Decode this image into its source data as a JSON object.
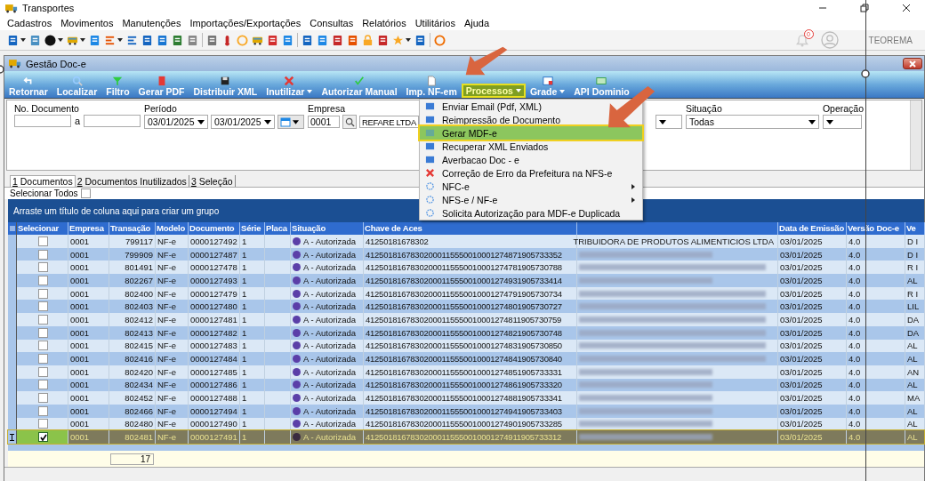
{
  "window": {
    "title": "Transportes"
  },
  "menu": [
    "Cadastros",
    "Movimentos",
    "Manutenções",
    "Importações/Exportações",
    "Consultas",
    "Relatórios",
    "Utilitários",
    "Ajuda"
  ],
  "notifications": {
    "count": "0"
  },
  "user": {
    "name": "TEOREMA"
  },
  "doc_window": {
    "title": "Gestão Doc-e",
    "ribbon": [
      {
        "label": "Retornar",
        "dropdown": false,
        "selected": false
      },
      {
        "label": "Localizar",
        "dropdown": false,
        "selected": false
      },
      {
        "label": "Filtro",
        "dropdown": false,
        "selected": false
      },
      {
        "label": "Gerar PDF",
        "dropdown": false,
        "selected": false
      },
      {
        "label": "Distribuir XML",
        "dropdown": false,
        "selected": false
      },
      {
        "label": "Inutilizar",
        "dropdown": true,
        "selected": false
      },
      {
        "label": "Autorizar Manual",
        "dropdown": false,
        "selected": false
      },
      {
        "label": "Imp. NF-em",
        "dropdown": false,
        "selected": false
      },
      {
        "label": "Processos",
        "dropdown": true,
        "selected": true
      },
      {
        "label": "Grade",
        "dropdown": true,
        "selected": false
      },
      {
        "label": "API Dominio",
        "dropdown": false,
        "selected": false
      }
    ],
    "filters": {
      "no_documento": {
        "label": "No. Documento",
        "separator": "a"
      },
      "periodo": {
        "label": "Período",
        "from": "03/01/2025",
        "to": "03/01/2025"
      },
      "empresa": {
        "label": "Empresa",
        "code": "0001",
        "name": "REFARE LTDA"
      },
      "situacao": {
        "label": "Situação",
        "value": "Todas"
      },
      "operacao": {
        "label": "Operação"
      }
    },
    "process_menu": [
      {
        "label": "Enviar Email (Pdf, XML)",
        "selected": false
      },
      {
        "label": "Reimpressão de Documento",
        "selected": false
      },
      {
        "label": "Gerar MDF-e",
        "selected": true
      },
      {
        "label": "Recuperar XML Enviados",
        "selected": false
      },
      {
        "label": "Averbacao Doc - e",
        "selected": false
      },
      {
        "label": "Correção de Erro da Prefeitura na NFS-e",
        "selected": false
      },
      {
        "label": "NFC-e",
        "selected": false,
        "submenu": true
      },
      {
        "label": "NFS-e / NF-e",
        "selected": false,
        "submenu": true
      },
      {
        "label": "Solicita Autorização para MDF-e Duplicada",
        "selected": false
      }
    ],
    "tabs": [
      {
        "number": "1",
        "label": " Documentos",
        "selected": true
      },
      {
        "number": "2",
        "label": " Documentos Inutilizados",
        "selected": false
      },
      {
        "number": "3",
        "label": " Seleção",
        "selected": false
      }
    ],
    "select_all": {
      "label": "Selecionar Todos",
      "checked": false
    },
    "group_hint": "Arraste um título de coluna aqui para criar um grupo",
    "columns": [
      "Selecionar",
      "Empresa",
      "Transação",
      "Modelo",
      "Documento",
      "Série",
      "Placa",
      "Situação",
      "Chave de Aces",
      null,
      "Data de Emissão",
      "Versão Doc-e",
      "Ve"
    ],
    "rows": [
      {
        "checked": false,
        "selected": false,
        "empresa": "0001",
        "transacao": "799117",
        "modelo": "NF-e",
        "documento": "0000127492",
        "serie": "1",
        "situacao": "A - Autorizada",
        "chave": "41250181678302",
        "name": "TRIBUIDORA DE PRODUTOS ALIMENTICIOS LTDA",
        "data": "03/01/2025",
        "versao": "4.0",
        "column_13": "D I"
      },
      {
        "checked": false,
        "selected": false,
        "empresa": "0001",
        "transacao": "799909",
        "modelo": "NF-e",
        "documento": "0000127487",
        "serie": "1",
        "situacao": "A - Autorizada",
        "chave": "41250181678302000115550010001274871905733352",
        "data": "03/01/2025",
        "versao": "4.0",
        "column_13": "D I"
      },
      {
        "checked": false,
        "selected": false,
        "empresa": "0001",
        "transacao": "801491",
        "modelo": "NF-e",
        "documento": "0000127478",
        "serie": "1",
        "situacao": "A - Autorizada",
        "chave": "41250181678302000115550010001274781905730788",
        "data": "03/01/2025",
        "versao": "4.0",
        "column_13": "R I"
      },
      {
        "checked": false,
        "selected": false,
        "empresa": "0001",
        "transacao": "802267",
        "modelo": "NF-e",
        "documento": "0000127493",
        "serie": "1",
        "situacao": "A - Autorizada",
        "chave": "41250181678302000115550010001274931905733414",
        "data": "03/01/2025",
        "versao": "4.0",
        "column_13": "AL"
      },
      {
        "checked": false,
        "selected": false,
        "empresa": "0001",
        "transacao": "802400",
        "modelo": "NF-e",
        "documento": "0000127479",
        "serie": "1",
        "situacao": "A - Autorizada",
        "chave": "41250181678302000115550010001274791905730734",
        "data": "03/01/2025",
        "versao": "4.0",
        "column_13": "R I"
      },
      {
        "checked": false,
        "selected": false,
        "empresa": "0001",
        "transacao": "802403",
        "modelo": "NF-e",
        "documento": "0000127480",
        "serie": "1",
        "situacao": "A - Autorizada",
        "chave": "41250181678302000115550010001274801905730727",
        "data": "03/01/2025",
        "versao": "4.0",
        "column_13": "LIL"
      },
      {
        "checked": false,
        "selected": false,
        "empresa": "0001",
        "transacao": "802412",
        "modelo": "NF-e",
        "documento": "0000127481",
        "serie": "1",
        "situacao": "A - Autorizada",
        "chave": "41250181678302000115550010001274811905730759",
        "data": "03/01/2025",
        "versao": "4.0",
        "column_13": "DA"
      },
      {
        "checked": false,
        "selected": false,
        "empresa": "0001",
        "transacao": "802413",
        "modelo": "NF-e",
        "documento": "0000127482",
        "serie": "1",
        "situacao": "A - Autorizada",
        "chave": "41250181678302000115550010001274821905730748",
        "data": "03/01/2025",
        "versao": "4.0",
        "column_13": "DA"
      },
      {
        "checked": false,
        "selected": false,
        "empresa": "0001",
        "transacao": "802415",
        "modelo": "NF-e",
        "documento": "0000127483",
        "serie": "1",
        "situacao": "A - Autorizada",
        "chave": "41250181678302000115550010001274831905730850",
        "data": "03/01/2025",
        "versao": "4.0",
        "column_13": "AL"
      },
      {
        "checked": false,
        "selected": false,
        "empresa": "0001",
        "transacao": "802416",
        "modelo": "NF-e",
        "documento": "0000127484",
        "serie": "1",
        "situacao": "A - Autorizada",
        "chave": "41250181678302000115550010001274841905730840",
        "data": "03/01/2025",
        "versao": "4.0",
        "column_13": "AL"
      },
      {
        "checked": false,
        "selected": false,
        "empresa": "0001",
        "transacao": "802420",
        "modelo": "NF-e",
        "documento": "0000127485",
        "serie": "1",
        "situacao": "A - Autorizada",
        "chave": "41250181678302000115550010001274851905733331",
        "data": "03/01/2025",
        "versao": "4.0",
        "column_13": "AN"
      },
      {
        "checked": false,
        "selected": false,
        "empresa": "0001",
        "transacao": "802434",
        "modelo": "NF-e",
        "documento": "0000127486",
        "serie": "1",
        "situacao": "A - Autorizada",
        "chave": "41250181678302000115550010001274861905733320",
        "data": "03/01/2025",
        "versao": "4.0",
        "column_13": "AL"
      },
      {
        "checked": false,
        "selected": false,
        "empresa": "0001",
        "transacao": "802452",
        "modelo": "NF-e",
        "documento": "0000127488",
        "serie": "1",
        "situacao": "A - Autorizada",
        "chave": "41250181678302000115550010001274881905733341",
        "data": "03/01/2025",
        "versao": "4.0",
        "column_13": "MA"
      },
      {
        "checked": false,
        "selected": false,
        "empresa": "0001",
        "transacao": "802466",
        "modelo": "NF-e",
        "documento": "0000127494",
        "serie": "1",
        "situacao": "A - Autorizada",
        "chave": "41250181678302000115550010001274941905733403",
        "data": "03/01/2025",
        "versao": "4.0",
        "column_13": "AL"
      },
      {
        "checked": false,
        "selected": false,
        "empresa": "0001",
        "transacao": "802480",
        "modelo": "NF-e",
        "documento": "0000127490",
        "serie": "1",
        "situacao": "A - Autorizada",
        "chave": "41250181678302000115550010001274901905733285",
        "data": "03/01/2025",
        "versao": "4.0",
        "column_13": "AL"
      },
      {
        "checked": true,
        "selected": true,
        "empresa": "0001",
        "transacao": "802481",
        "modelo": "NF-e",
        "documento": "0000127491",
        "serie": "1",
        "situacao": "A - Autorizada",
        "chave": "41250181678302000115550010001274911905733312",
        "data": "03/01/2025",
        "versao": "4.0",
        "column_13": "AL"
      }
    ],
    "footer": {
      "count": "17"
    }
  }
}
